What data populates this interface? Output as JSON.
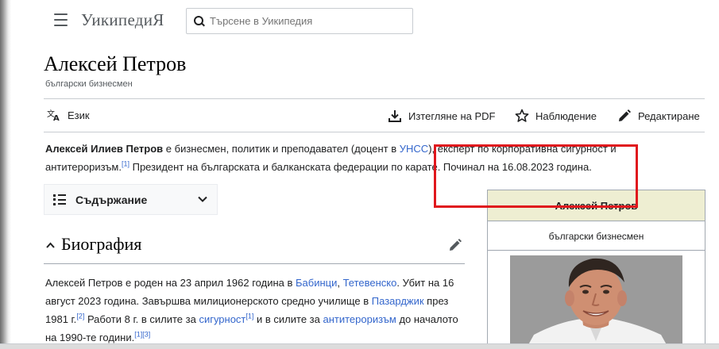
{
  "header": {
    "logo": "УикипедиЯ",
    "search_placeholder": "Търсене в Уикипедия"
  },
  "article": {
    "title": "Алексей Петров",
    "subtitle": "български бизнесмен"
  },
  "toolbar": {
    "language": "Език",
    "download_pdf": "Изтегляне на PDF",
    "watch": "Наблюдение",
    "edit": "Редактиране"
  },
  "lead": {
    "name": "Алексей Илиев Петров",
    "text1": " е бизнесмен, политик и преподавател (доцент в ",
    "link_unss": "УНСС",
    "text2": "), експерт по корпоративна сигурност и антитероризъм.",
    "ref1": "[1]",
    "text3": " Президент на българската и балканската федерации по карате. Почи­нал на 16.08.2023 година."
  },
  "toc": {
    "label": "Съдържание"
  },
  "biography": {
    "heading": "Биография",
    "t1": "Алексей Петров е роден на 23 април 1962 година в ",
    "link_babintsi": "Бабинци",
    "comma": ", ",
    "link_teteven": "Тетевенско",
    "t2": ". Убит на 16 август 2023 година. Завършва милиционерското средно училище в ",
    "link_pazardzhik": "Пазарджик",
    "t3": " през 1981 г.",
    "ref2": "[2]",
    "t4": " Работи 8 г. в силите за ",
    "link_security": "сигурност",
    "ref1": "[1]",
    "t5": " и в силите за ",
    "link_antiterror": "антитероризъм",
    "t6": " до началото на 1990-те години.",
    "ref13": "[1][3]"
  },
  "infobox": {
    "title": "Алексей Петров",
    "subtitle": "български бизнесмен"
  },
  "colors": {
    "link": "#3366cc",
    "annotation_box": "#e0171d",
    "infobox_header": "#eeeed2"
  },
  "icons": {
    "menu": "hamburger-icon",
    "search": "search-icon",
    "language": "translate-icon",
    "download": "download-icon",
    "watch": "star-icon",
    "edit": "pencil-icon",
    "toc": "list-icon",
    "toc_toggle": "chevron-down-icon",
    "section_toggle": "chevron-up-icon"
  }
}
